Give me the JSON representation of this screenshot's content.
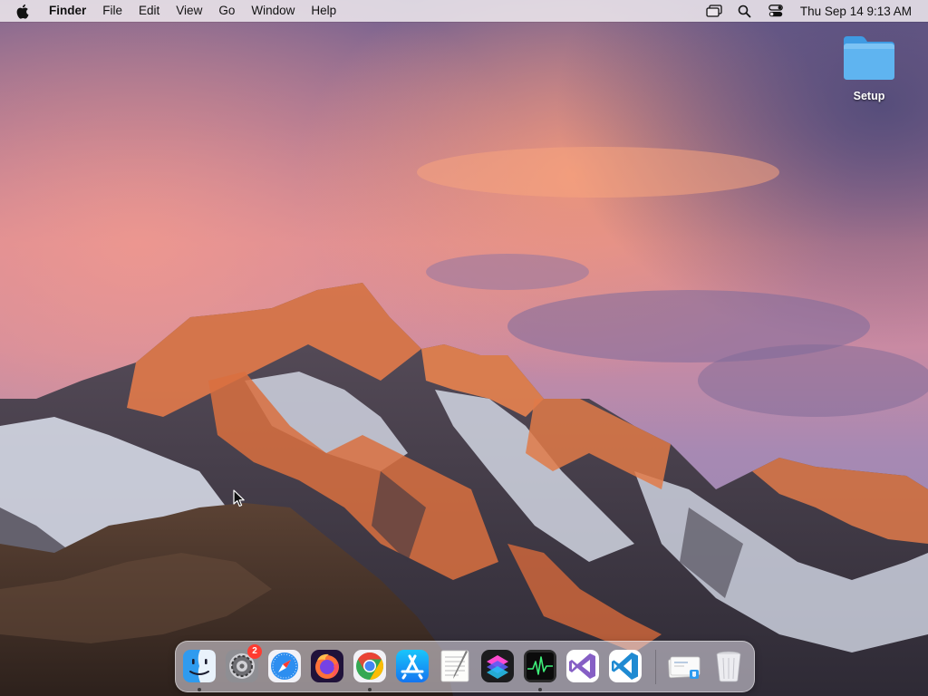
{
  "menubar": {
    "app_name": "Finder",
    "menus": [
      "File",
      "Edit",
      "View",
      "Go",
      "Window",
      "Help"
    ],
    "clock": "Thu Sep 14  9:13 AM",
    "status_icons": [
      "screen-mirroring-icon",
      "spotlight-search-icon",
      "control-center-icon"
    ]
  },
  "desktop": {
    "items": [
      {
        "label": "Setup",
        "icon": "folder-icon"
      }
    ]
  },
  "dock": {
    "apps": [
      {
        "name": "Finder",
        "icon": "finder-icon",
        "running": true
      },
      {
        "name": "System Settings",
        "icon": "system-settings-icon",
        "badge": "2"
      },
      {
        "name": "Safari",
        "icon": "safari-icon"
      },
      {
        "name": "Firefox",
        "icon": "firefox-icon"
      },
      {
        "name": "Google Chrome",
        "icon": "chrome-icon",
        "running": true
      },
      {
        "name": "App Store",
        "icon": "app-store-icon"
      },
      {
        "name": "TextEdit",
        "icon": "textedit-icon"
      },
      {
        "name": "Shortcuts",
        "icon": "shortcuts-icon"
      },
      {
        "name": "Activity Monitor",
        "icon": "activity-monitor-icon",
        "running": true
      },
      {
        "name": "Visual Studio",
        "icon": "visual-studio-icon"
      },
      {
        "name": "Visual Studio Code",
        "icon": "vscode-icon"
      },
      {
        "name": "Downloads Stack",
        "icon": "downloads-stack-icon"
      },
      {
        "name": "Trash",
        "icon": "trash-icon"
      }
    ]
  },
  "colors": {
    "menubar_bg": "#ece6ec",
    "folder_blue": "#4aa8ea",
    "badge_red": "#ff3b30"
  }
}
